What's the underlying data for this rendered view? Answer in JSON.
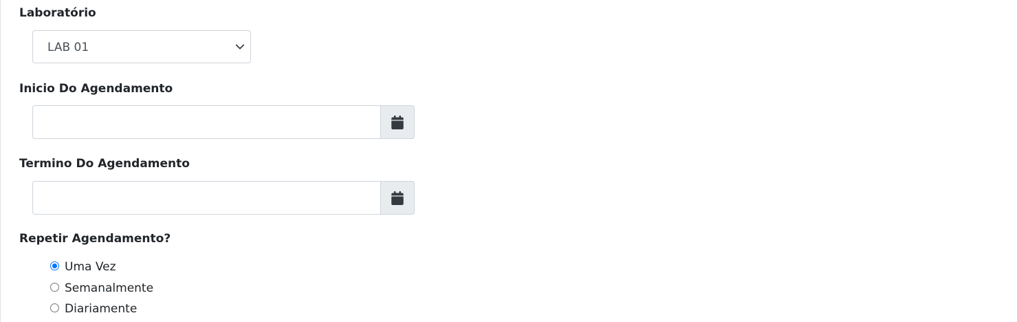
{
  "lab": {
    "label": "Laboratório",
    "selected": "LAB 01"
  },
  "start": {
    "label": "Inicio Do Agendamento",
    "value": "",
    "icon": "calendar-icon"
  },
  "end": {
    "label": "Termino Do Agendamento",
    "value": "",
    "icon": "calendar-icon"
  },
  "repeat": {
    "label": "Repetir Agendamento?",
    "options": [
      {
        "label": "Uma Vez",
        "checked": true
      },
      {
        "label": "Semanalmente",
        "checked": false
      },
      {
        "label": "Diariamente",
        "checked": false
      }
    ]
  },
  "colors": {
    "radio_accent": "#0075ff",
    "addon_bg": "#e9ecef",
    "border": "#ced4da"
  }
}
